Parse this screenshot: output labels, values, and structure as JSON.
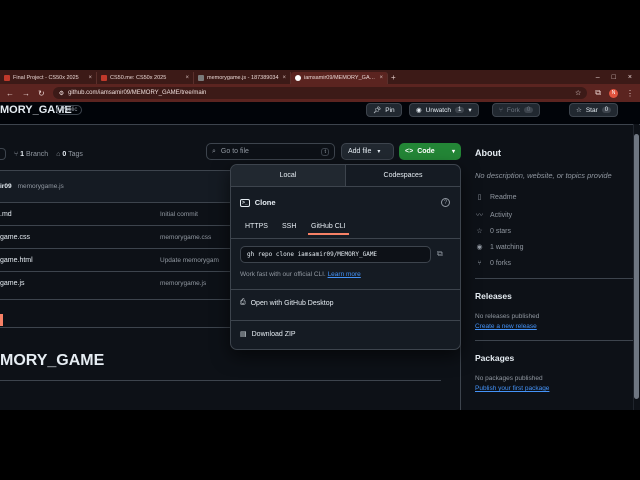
{
  "browser": {
    "tabs": [
      {
        "title": "Final Project - CS50x 2025",
        "color": "#c0392b"
      },
      {
        "title": "CS50.me: CS50x 2025",
        "color": "#c0392b"
      },
      {
        "title": "memorygame.js - 187389034",
        "color": "#7a7a7a"
      },
      {
        "title": "iamsamir09/MEMORY_GAME",
        "color": "#ffffff"
      }
    ],
    "url": "github.com/iamsamir09/MEMORY_GAME/tree/main",
    "profile_initial": "N"
  },
  "repo": {
    "name": "MORY_GAME",
    "visibility": "Public",
    "pin_label": "Pin",
    "unwatch_label": "Unwatch",
    "unwatch_count": "1",
    "fork_label": "Fork",
    "fork_count": "0",
    "star_label": "Star",
    "star_count": "0"
  },
  "toolbar": {
    "branch_count": "1",
    "branch_label": "Branch",
    "tag_count": "0",
    "tag_label": "Tags",
    "search_placeholder": "Go to file",
    "search_kbd": "t",
    "add_file_label": "Add file",
    "code_label": "Code"
  },
  "commit": {
    "user": "ir09",
    "message": "memorygame.js"
  },
  "files": [
    {
      "name": ".md",
      "message": "Initial commit"
    },
    {
      "name": "game.css",
      "message": "memorygame.css"
    },
    {
      "name": "game.html",
      "message": "Update memorygam"
    },
    {
      "name": "game.js",
      "message": "memorygame.js"
    }
  ],
  "readme": {
    "heading": "MORY_GAME"
  },
  "clone": {
    "tabs": [
      "Local",
      "Codespaces"
    ],
    "title": "Clone",
    "protocols": [
      "HTTPS",
      "SSH",
      "GitHub CLI"
    ],
    "active_protocol": "GitHub CLI",
    "command": "gh repo clone iamsamir09/MEMORY_GAME",
    "hint_text": "Work fast with our official CLI.",
    "hint_link": "Learn more",
    "open_desktop": "Open with GitHub Desktop",
    "download_zip": "Download ZIP"
  },
  "sidebar": {
    "about_title": "About",
    "about_desc": "No description, website, or topics provide",
    "items": [
      {
        "icon": "book-icon",
        "label": "Readme"
      },
      {
        "icon": "pulse-icon",
        "label": "Activity"
      },
      {
        "icon": "star-icon",
        "label": "0 stars"
      },
      {
        "icon": "eye-icon",
        "label": "1 watching"
      },
      {
        "icon": "fork-icon",
        "label": "0 forks"
      }
    ],
    "releases_title": "Releases",
    "releases_none": "No releases published",
    "releases_link": "Create a new release",
    "packages_title": "Packages",
    "packages_none": "No packages published",
    "packages_link": "Publish your first package"
  },
  "colors": {
    "accent_green": "#238636",
    "link_blue": "#4493f8",
    "tab_underline": "#f78166",
    "browser_frame": "#5b2420"
  }
}
